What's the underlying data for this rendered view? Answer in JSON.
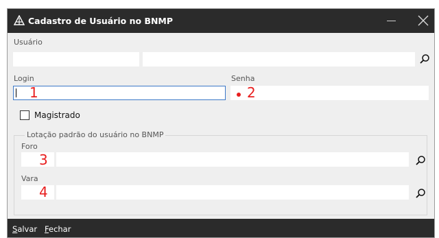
{
  "window": {
    "title": "Cadastro de Usuário no BNMP"
  },
  "usuario": {
    "label": "Usuário",
    "code_value": "",
    "name_value": "",
    "search_icon": "search-icon"
  },
  "login": {
    "label": "Login",
    "value": "",
    "marker": "1"
  },
  "senha": {
    "label": "Senha",
    "value": "",
    "marker": "2"
  },
  "magistrado": {
    "label": "Magistrado",
    "checked": false
  },
  "lotacao": {
    "title": "Lotação padrão do usuário no BNMP",
    "foro": {
      "label": "Foro",
      "code_value": "",
      "name_value": "",
      "marker": "3"
    },
    "vara": {
      "label": "Vara",
      "code_value": "",
      "name_value": "",
      "marker": "4"
    }
  },
  "actions": {
    "salvar": {
      "mnemonic": "S",
      "rest": "alvar"
    },
    "fechar": {
      "mnemonic": "F",
      "rest": "echar"
    }
  },
  "colors": {
    "titlebar": "#2b2b2b",
    "body": "#efefef",
    "focus_border": "#3b78c8",
    "marker_red": "#e81e1e"
  }
}
